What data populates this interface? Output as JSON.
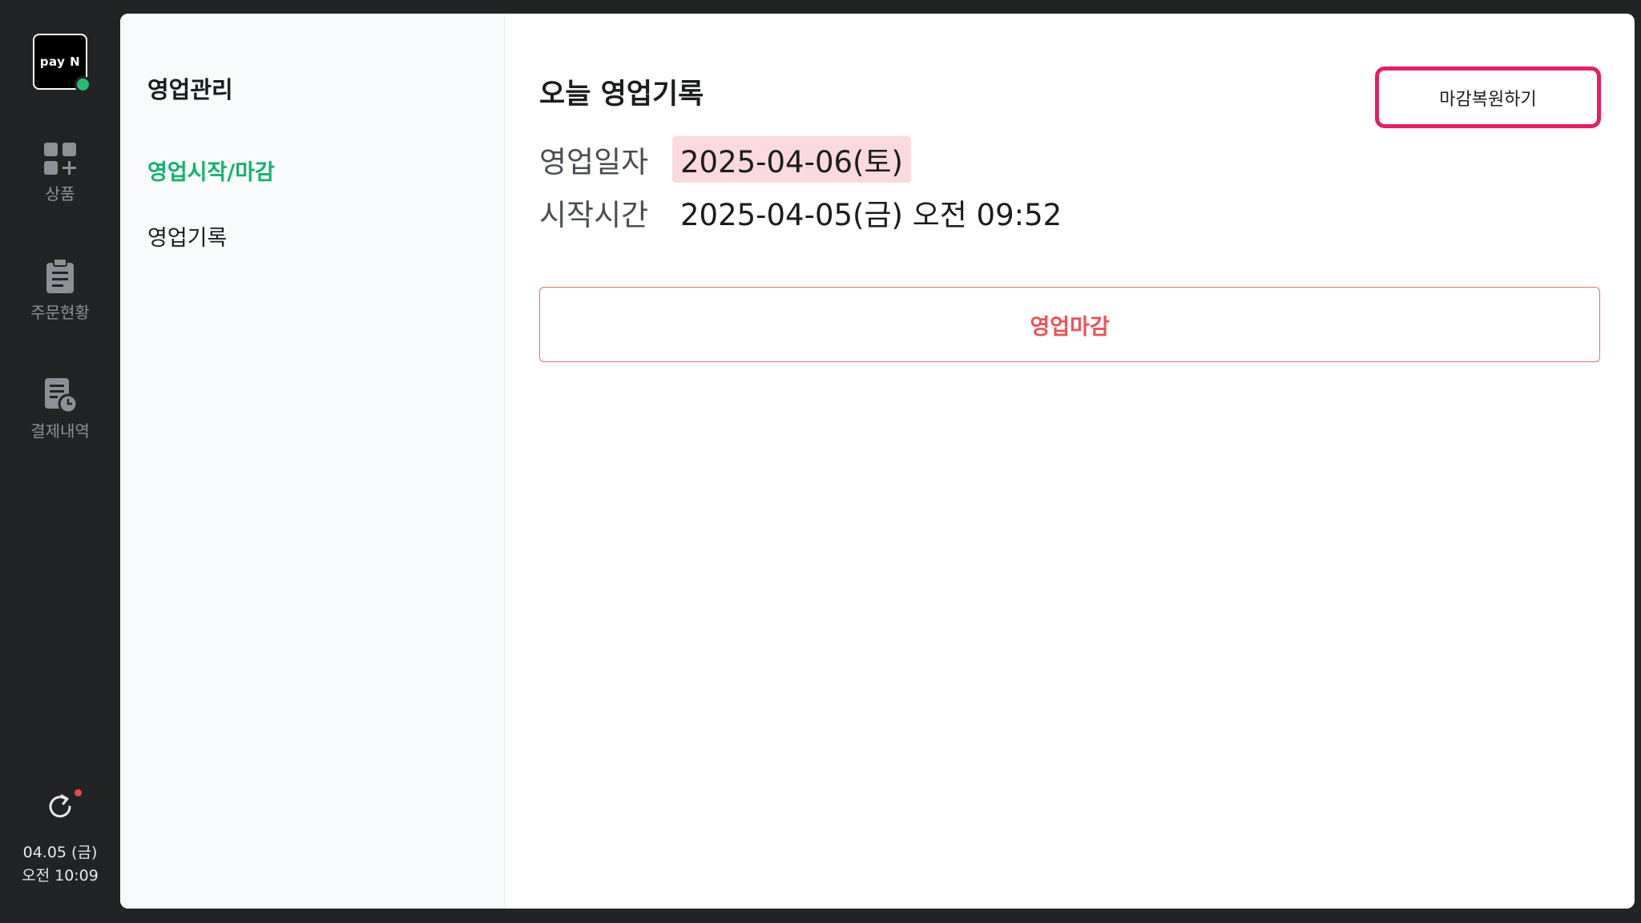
{
  "sidebar": {
    "logo_text": "pay N",
    "items": [
      {
        "label": "상품",
        "icon": "product-grid-icon"
      },
      {
        "label": "주문현황",
        "icon": "clipboard-icon"
      },
      {
        "label": "결제내역",
        "icon": "receipt-clock-icon"
      }
    ],
    "datetime": {
      "date": "04.05 (금)",
      "time": "오전 10:09"
    },
    "refresh_icon": "refresh-icon"
  },
  "subnav": {
    "title": "영업관리",
    "items": [
      {
        "label": "영업시작/마감",
        "active": true
      },
      {
        "label": "영업기록",
        "active": false
      }
    ]
  },
  "main": {
    "title": "오늘 영업기록",
    "restore_button": "마감복원하기",
    "rows": [
      {
        "label": "영업일자",
        "value": "2025-04-06(토)"
      },
      {
        "label": "시작시간",
        "value": "2025-04-05(금) 오전 09:52"
      }
    ],
    "close_button": "영업마감"
  },
  "colors": {
    "accent_green": "#14b36a",
    "alert_red": "#ee5257",
    "highlight_pink": "#fbd9df",
    "focus_border": "#ec1c5f",
    "rail_bg": "#222325"
  }
}
